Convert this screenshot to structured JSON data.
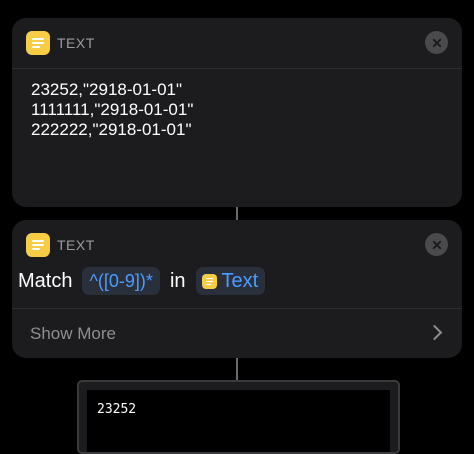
{
  "text_action": {
    "title": "TEXT",
    "content": "23252,\"2918-01-01\"\n1111111,\"2918-01-01\"\n222222,\"2918-01-01\""
  },
  "match_action": {
    "title": "TEXT",
    "match_label": "Match",
    "pattern": "^([0-9])*",
    "in_label": "in",
    "input_variable": "Text",
    "show_more_label": "Show More"
  },
  "result": {
    "value": "23252"
  },
  "icons": {
    "action_icon": "text-document-icon",
    "close": "close-icon",
    "chevron": "chevron-right-icon"
  },
  "colors": {
    "background": "#000000",
    "card": "#1c1c1e",
    "icon_yellow": "#f7cd45",
    "token_text": "#4a9cff",
    "secondary_text": "#8e8e93"
  }
}
